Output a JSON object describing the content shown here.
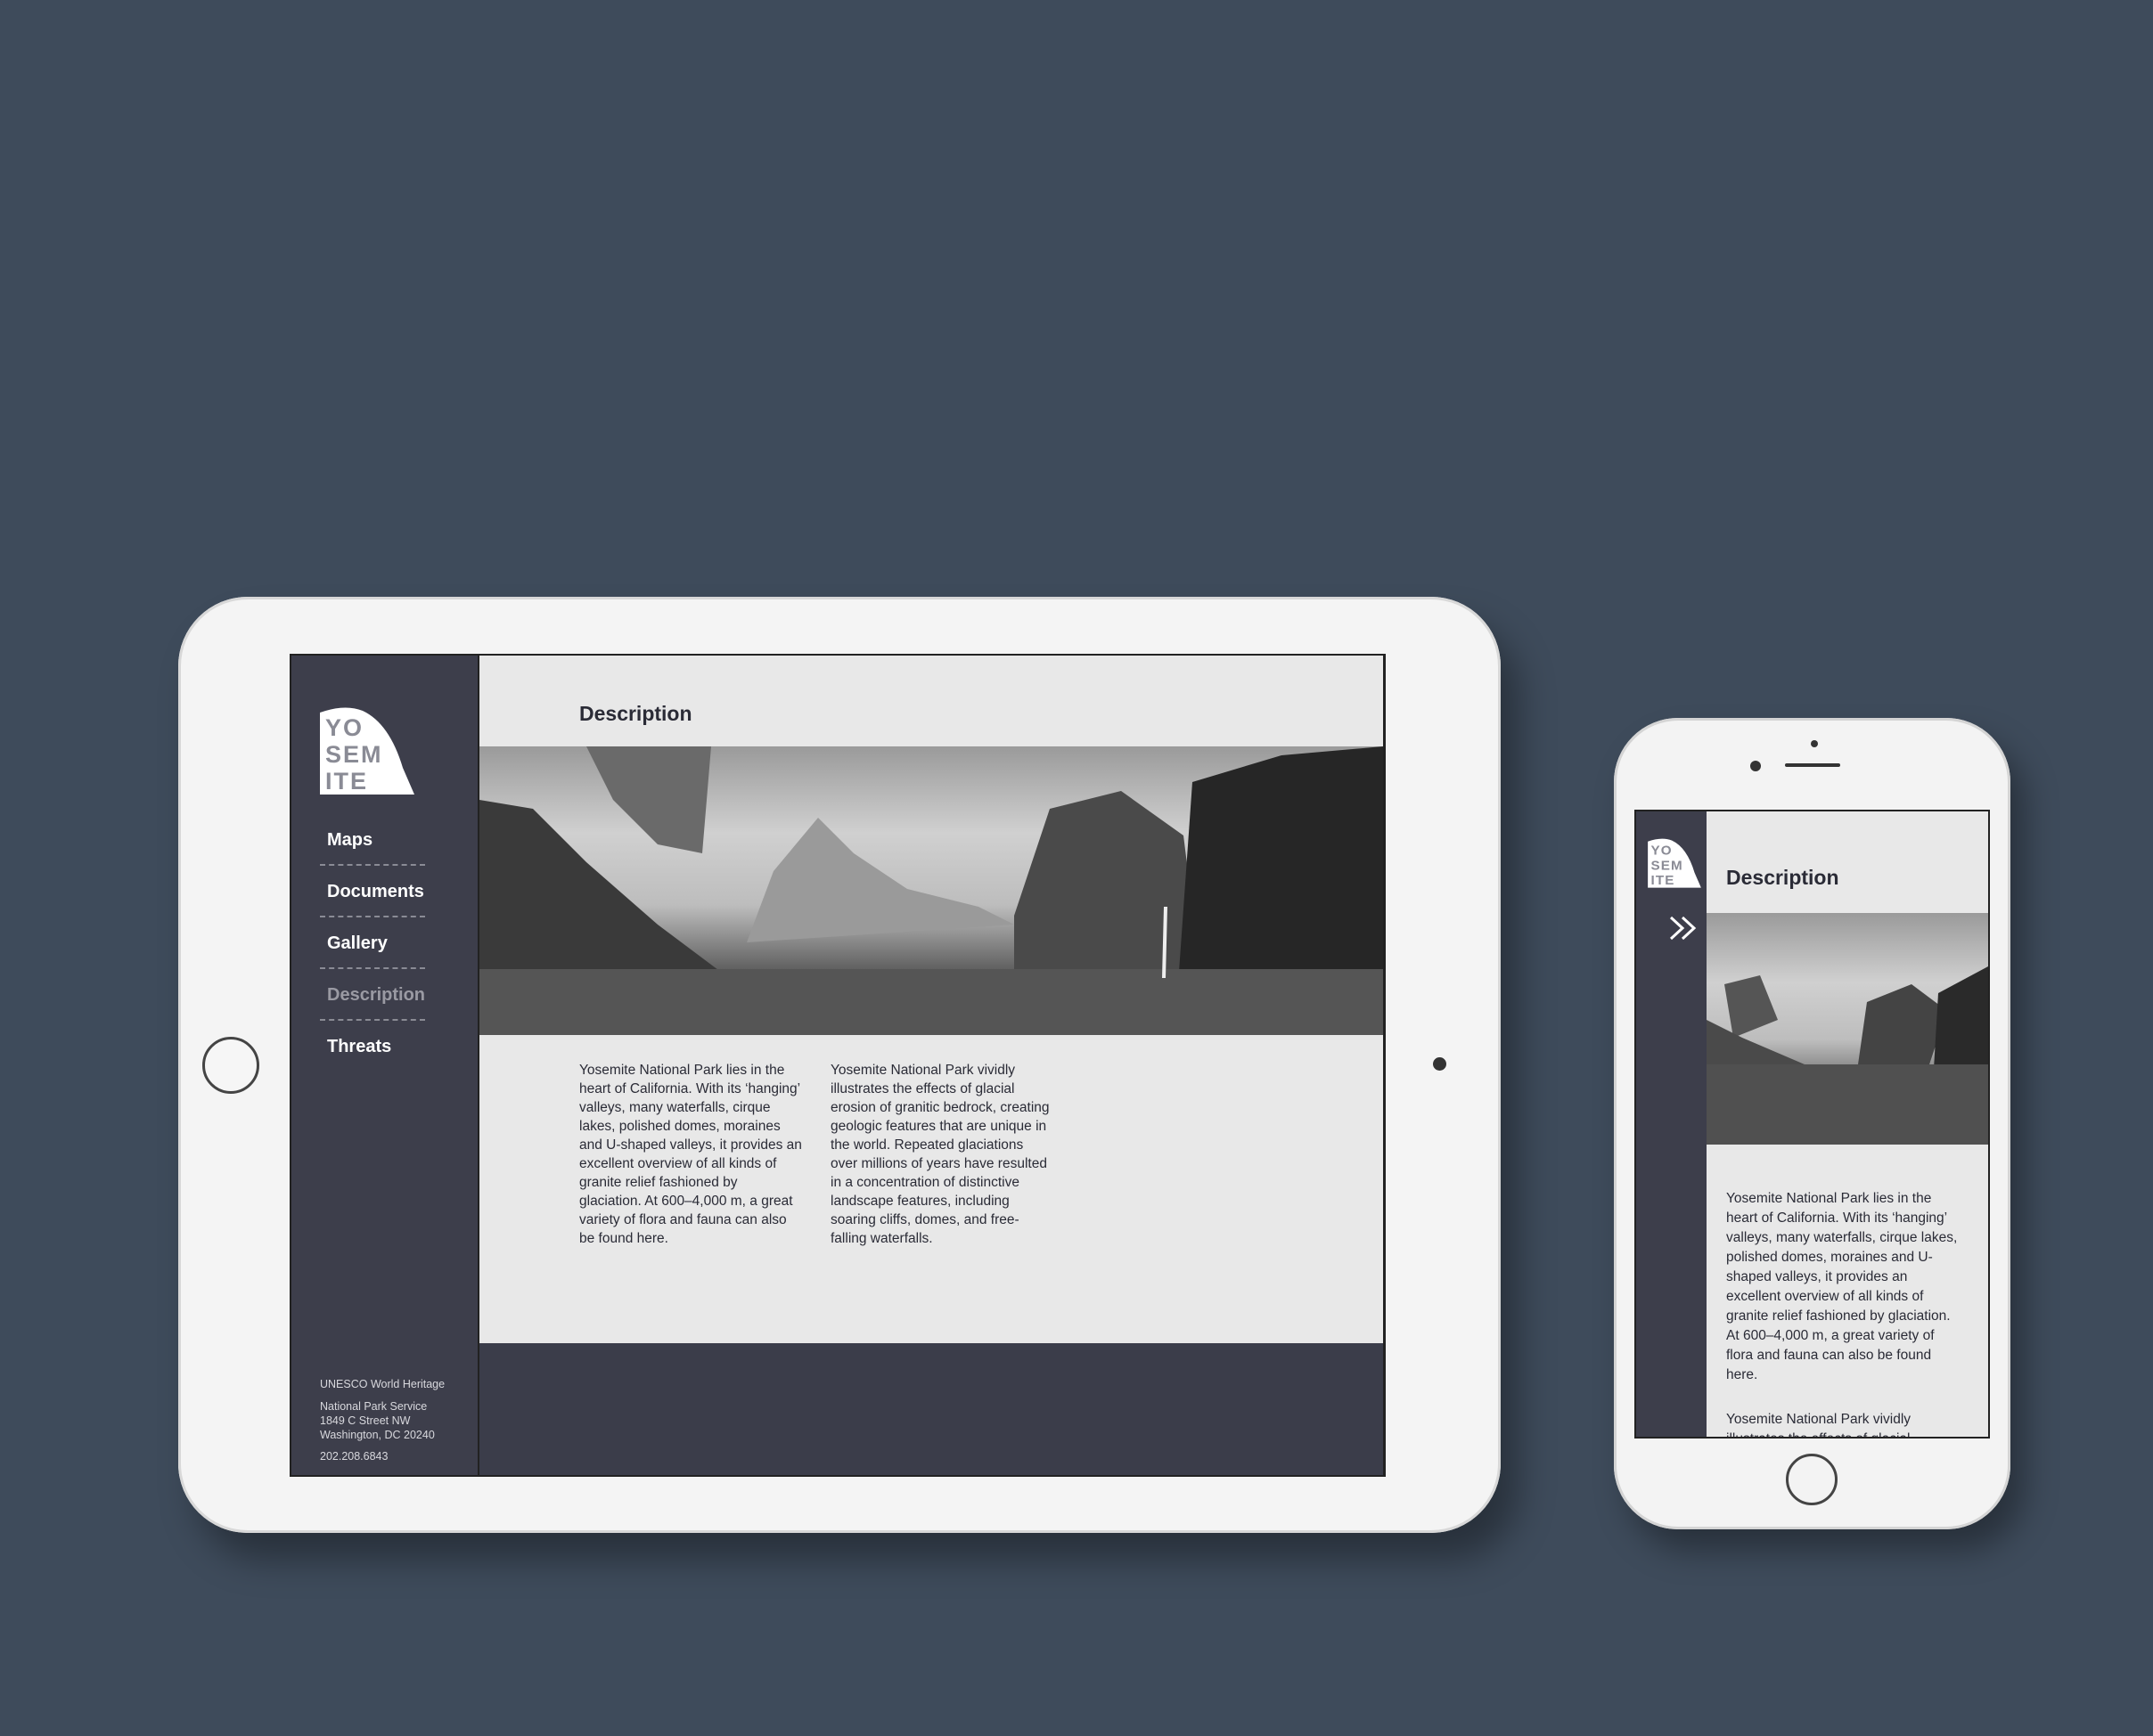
{
  "brand": {
    "logo_lines": [
      "YO",
      "SEM",
      "ITE"
    ]
  },
  "tablet": {
    "page_title": "Description",
    "nav": [
      {
        "label": "Maps"
      },
      {
        "label": "Documents"
      },
      {
        "label": "Gallery"
      },
      {
        "label": "Description",
        "active": true
      },
      {
        "label": "Threats"
      }
    ],
    "paragraphs": [
      "Yosemite National Park lies in the heart of California. With its ‘hanging’ valleys, many waterfalls, cirque lakes, polished domes, moraines and U-shaped valleys, it provides an excellent overview of all kinds of granite relief fashioned by glaciation. At 600–4,000 m, a great variety of flora and fauna can also be found here.",
      "Yosemite National Park vividly illustrates the effects of glacial erosion of granitic bedrock, creating geologic features that are unique in the world. Repeated glaciations over millions of years have resulted in a concentration of distinctive landscape features, including soaring cliffs, domes, and free-falling waterfalls."
    ],
    "footer": {
      "heading": "UNESCO World Heritage",
      "address": [
        "National Park Service",
        "1849 C Street NW",
        "Washington, DC 20240"
      ],
      "phone": "202.208.6843"
    }
  },
  "phone": {
    "page_title": "Description",
    "menu_icon": "double-chevron-right-icon",
    "paragraphs": [
      "Yosemite National Park lies in the heart of California. With its ‘hanging’ valleys, many waterfalls, cirque lakes, polished domes, moraines and U-shaped valleys, it provides an excellent overview of all kinds of granite relief fashioned by glaciation. At 600–4,000 m, a great variety of flora and fauna can also be found here.",
      "Yosemite National Park vividly illustrates the effects of glacial"
    ]
  },
  "colors": {
    "background": "#3e4b5b",
    "sidebar": "#3d3e4b",
    "content": "#e8e8e8",
    "text": "#2a2b36"
  }
}
